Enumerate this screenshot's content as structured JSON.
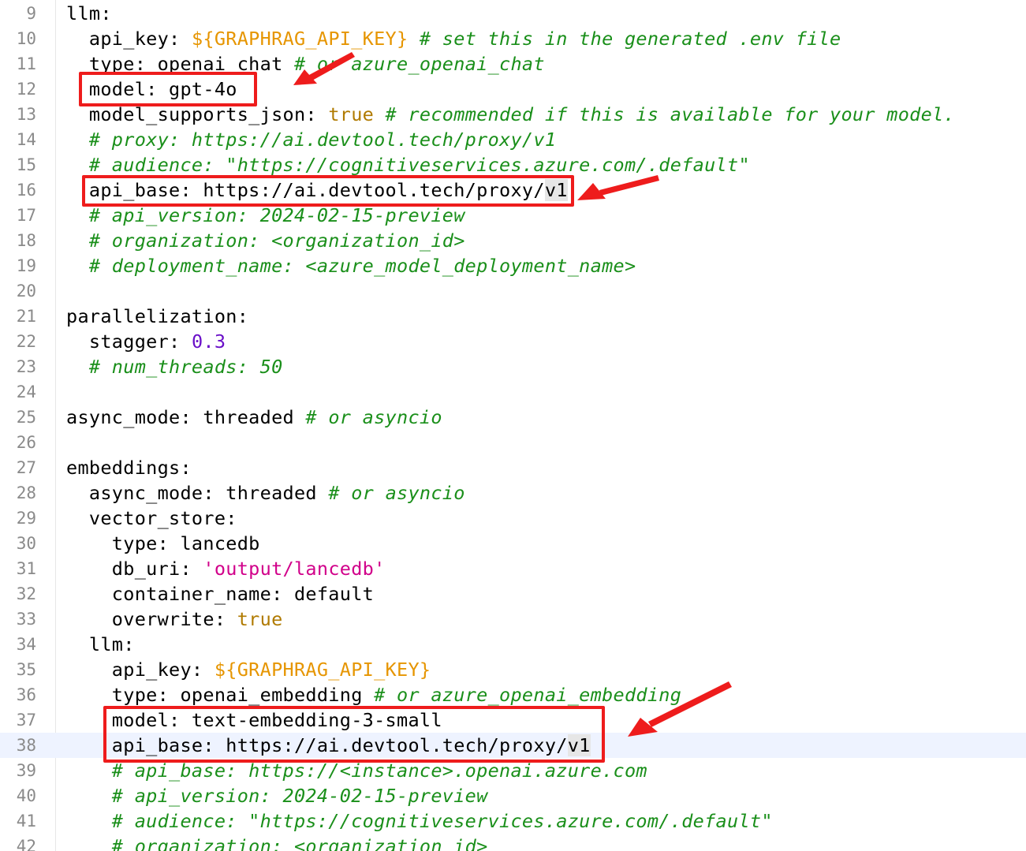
{
  "editor": {
    "lines": [
      {
        "num": "9",
        "tokens": [
          {
            "t": "llm:",
            "c": ""
          }
        ]
      },
      {
        "num": "10",
        "tokens": [
          {
            "t": "  api_key: ",
            "c": ""
          },
          {
            "t": "${GRAPHRAG_API_KEY}",
            "c": "tok-var"
          },
          {
            "t": " # set this in the generated .env file",
            "c": "tok-com"
          }
        ]
      },
      {
        "num": "11",
        "tokens": [
          {
            "t": "  type: openai_chat",
            "c": ""
          },
          {
            "t": " # or azure_openai_chat",
            "c": "tok-com"
          }
        ]
      },
      {
        "num": "12",
        "tokens": [
          {
            "t": "  model: gpt-4o",
            "c": ""
          }
        ]
      },
      {
        "num": "13",
        "tokens": [
          {
            "t": "  model_supports_json: ",
            "c": ""
          },
          {
            "t": "true",
            "c": "tok-bool"
          },
          {
            "t": " # recommended if this is available for your model.",
            "c": "tok-com"
          }
        ]
      },
      {
        "num": "14",
        "tokens": [
          {
            "t": "  # proxy: https://ai.devtool.tech/proxy/v1",
            "c": "tok-com"
          }
        ]
      },
      {
        "num": "15",
        "tokens": [
          {
            "t": "  # audience: \"https://cognitiveservices.azure.com/.default\"",
            "c": "tok-com"
          }
        ]
      },
      {
        "num": "16",
        "tokens": [
          {
            "t": "  api_base: https://ai.devtool.tech/proxy/",
            "c": ""
          },
          {
            "t": "v1",
            "c": "sel"
          }
        ]
      },
      {
        "num": "17",
        "tokens": [
          {
            "t": "  # api_version: 2024-02-15-preview",
            "c": "tok-com"
          }
        ]
      },
      {
        "num": "18",
        "tokens": [
          {
            "t": "  # organization: <organization_id>",
            "c": "tok-com"
          }
        ]
      },
      {
        "num": "19",
        "tokens": [
          {
            "t": "  # deployment_name: <azure_model_deployment_name>",
            "c": "tok-com"
          }
        ]
      },
      {
        "num": "20",
        "tokens": []
      },
      {
        "num": "21",
        "tokens": [
          {
            "t": "parallelization:",
            "c": ""
          }
        ]
      },
      {
        "num": "22",
        "tokens": [
          {
            "t": "  stagger: ",
            "c": ""
          },
          {
            "t": "0.3",
            "c": "tok-num"
          }
        ]
      },
      {
        "num": "23",
        "tokens": [
          {
            "t": "  # num_threads: 50",
            "c": "tok-com"
          }
        ]
      },
      {
        "num": "24",
        "tokens": []
      },
      {
        "num": "25",
        "tokens": [
          {
            "t": "async_mode: threaded",
            "c": ""
          },
          {
            "t": " # or asyncio",
            "c": "tok-com"
          }
        ]
      },
      {
        "num": "26",
        "tokens": []
      },
      {
        "num": "27",
        "tokens": [
          {
            "t": "embeddings:",
            "c": ""
          }
        ]
      },
      {
        "num": "28",
        "tokens": [
          {
            "t": "  async_mode: threaded",
            "c": ""
          },
          {
            "t": " # or asyncio",
            "c": "tok-com"
          }
        ]
      },
      {
        "num": "29",
        "tokens": [
          {
            "t": "  vector_store:",
            "c": ""
          }
        ]
      },
      {
        "num": "30",
        "tokens": [
          {
            "t": "    type: lancedb",
            "c": ""
          }
        ]
      },
      {
        "num": "31",
        "tokens": [
          {
            "t": "    db_uri: ",
            "c": ""
          },
          {
            "t": "'output/lancedb'",
            "c": "tok-str"
          }
        ]
      },
      {
        "num": "32",
        "tokens": [
          {
            "t": "    container_name: default",
            "c": ""
          }
        ]
      },
      {
        "num": "33",
        "tokens": [
          {
            "t": "    overwrite: ",
            "c": ""
          },
          {
            "t": "true",
            "c": "tok-bool"
          }
        ]
      },
      {
        "num": "34",
        "tokens": [
          {
            "t": "  llm:",
            "c": ""
          }
        ]
      },
      {
        "num": "35",
        "tokens": [
          {
            "t": "    api_key: ",
            "c": ""
          },
          {
            "t": "${GRAPHRAG_API_KEY}",
            "c": "tok-var"
          }
        ]
      },
      {
        "num": "36",
        "tokens": [
          {
            "t": "    type: openai_embedding",
            "c": ""
          },
          {
            "t": " # or azure_openai_embedding",
            "c": "tok-com"
          }
        ]
      },
      {
        "num": "37",
        "tokens": [
          {
            "t": "    model: text-embedding-3-small",
            "c": ""
          }
        ]
      },
      {
        "num": "38",
        "tokens": [
          {
            "t": "    api_base: https://ai.devtool.tech/proxy/",
            "c": ""
          },
          {
            "t": "v1",
            "c": "sel"
          }
        ],
        "current": true
      },
      {
        "num": "39",
        "tokens": [
          {
            "t": "    # api_base: https://<instance>.openai.azure.com",
            "c": "tok-com"
          }
        ]
      },
      {
        "num": "40",
        "tokens": [
          {
            "t": "    # api_version: 2024-02-15-preview",
            "c": "tok-com"
          }
        ]
      },
      {
        "num": "41",
        "tokens": [
          {
            "t": "    # audience: \"https://cognitiveservices.azure.com/.default\"",
            "c": "tok-com"
          }
        ]
      },
      {
        "num": "42",
        "tokens": [
          {
            "t": "    # organization: <organization_id>",
            "c": "tok-com"
          }
        ]
      }
    ]
  },
  "colors": {
    "annotation": "#ee1c1c",
    "comment": "#1a8f1a",
    "variable": "#e69500",
    "boolean": "#b07a00",
    "number": "#6a10c8",
    "string": "#d1008a"
  }
}
